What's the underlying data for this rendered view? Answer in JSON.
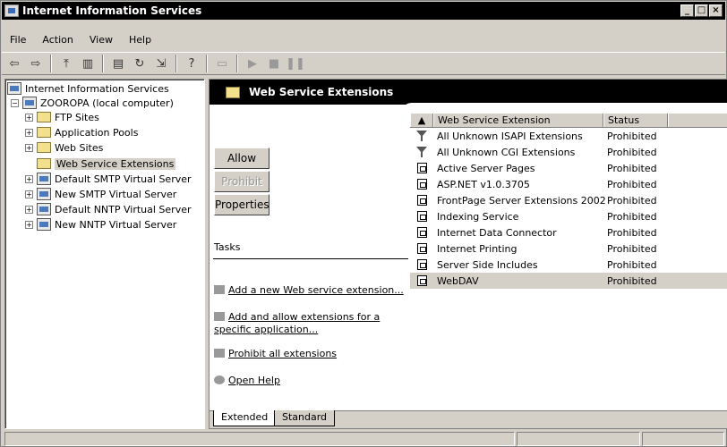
{
  "window": {
    "title": "Internet Information Services"
  },
  "menu": [
    "File",
    "Action",
    "View",
    "Help"
  ],
  "toolbar": [
    "back-icon",
    "forward-icon",
    "up-icon",
    "show-hide-tree-icon",
    "properties-icon",
    "refresh-icon",
    "export-icon",
    "help-icon",
    "computer-icon",
    "play-icon",
    "stop-icon",
    "pause-icon"
  ],
  "tree": {
    "root": "Internet Information Services",
    "computer": "ZOOROPA (local computer)",
    "items": [
      {
        "label": "FTP Sites",
        "icon": "folder-icon"
      },
      {
        "label": "Application Pools",
        "icon": "folder-icon"
      },
      {
        "label": "Web Sites",
        "icon": "folder-icon"
      },
      {
        "label": "Web Service Extensions",
        "icon": "folder-icon"
      },
      {
        "label": "Default SMTP Virtual Server",
        "icon": "smtp-server-icon"
      },
      {
        "label": "New SMTP Virtual Server",
        "icon": "smtp-server-icon"
      },
      {
        "label": "Default NNTP Virtual Server",
        "icon": "nntp-server-icon"
      },
      {
        "label": "New NNTP Virtual Server",
        "icon": "nntp-server-icon"
      }
    ]
  },
  "panel": {
    "title": "Web Service Extensions",
    "buttons": {
      "allow": "Allow",
      "prohibit": "Prohibit",
      "properties": "Properties"
    },
    "tasks_title": "Tasks",
    "tasks": [
      "Add a new Web service extension...",
      "Add and allow extensions for a specific application...",
      "Prohibit all extensions",
      "Open Help"
    ]
  },
  "list": {
    "columns": [
      "Web Service Extension",
      "Status"
    ],
    "rows": [
      {
        "name": "All Unknown ISAPI Extensions",
        "status": "Prohibited",
        "icon": "filter-icon"
      },
      {
        "name": "All Unknown CGI Extensions",
        "status": "Prohibited",
        "icon": "filter-icon"
      },
      {
        "name": "Active Server Pages",
        "status": "Prohibited",
        "icon": "extension-icon"
      },
      {
        "name": "ASP.NET v1.0.3705",
        "status": "Prohibited",
        "icon": "extension-icon"
      },
      {
        "name": "FrontPage Server Extensions 2002",
        "status": "Prohibited",
        "icon": "extension-icon"
      },
      {
        "name": "Indexing Service",
        "status": "Prohibited",
        "icon": "extension-icon"
      },
      {
        "name": "Internet Data Connector",
        "status": "Prohibited",
        "icon": "extension-icon"
      },
      {
        "name": "Internet Printing",
        "status": "Prohibited",
        "icon": "extension-icon"
      },
      {
        "name": "Server Side Includes",
        "status": "Prohibited",
        "icon": "extension-icon"
      },
      {
        "name": "WebDAV",
        "status": "Prohibited",
        "icon": "extension-icon"
      }
    ]
  },
  "tabs": [
    "Extended",
    "Standard"
  ]
}
